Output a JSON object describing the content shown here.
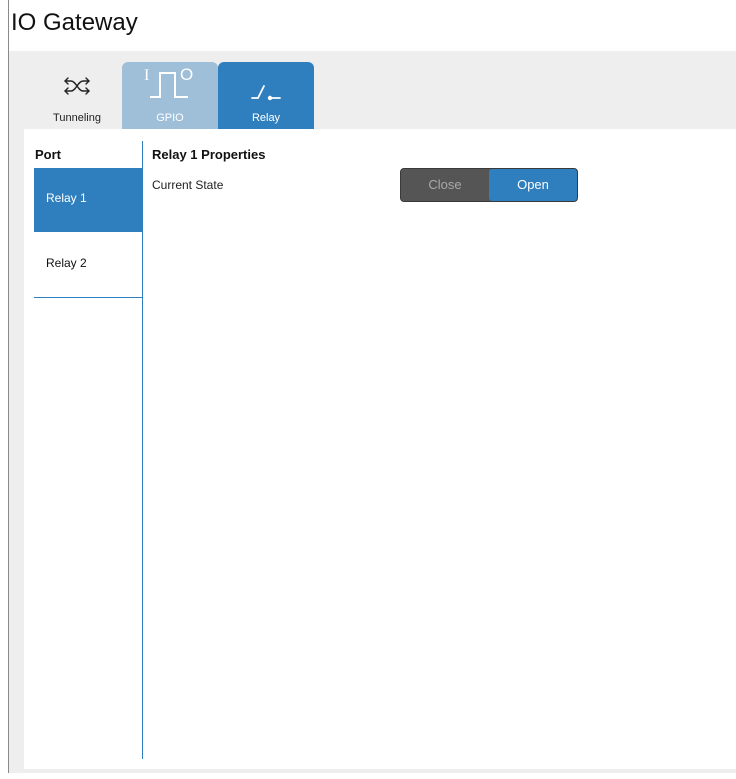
{
  "window": {
    "title": "IO Gateway"
  },
  "tabs": [
    {
      "label": "Tunneling",
      "icon": "shuffle-arrows-icon",
      "state": "default"
    },
    {
      "label": "GPIO",
      "icon": "gpio-pulse-icon",
      "state": "inactive-highlight"
    },
    {
      "label": "Relay",
      "icon": "relay-switch-icon",
      "state": "selected"
    }
  ],
  "port_panel": {
    "header": "Port",
    "items": [
      {
        "label": "Relay 1",
        "selected": true
      },
      {
        "label": "Relay 2",
        "selected": false
      }
    ]
  },
  "properties": {
    "title": "Relay 1 Properties",
    "current_state_label": "Current State",
    "toggle": {
      "options": [
        "Close",
        "Open"
      ],
      "selected": "Open"
    }
  },
  "colors": {
    "accent": "#2f7fbf",
    "tab_gpio": "#9fbfd9",
    "toggle_off": "#555555",
    "tab_bar_bg": "#eeeeee"
  }
}
